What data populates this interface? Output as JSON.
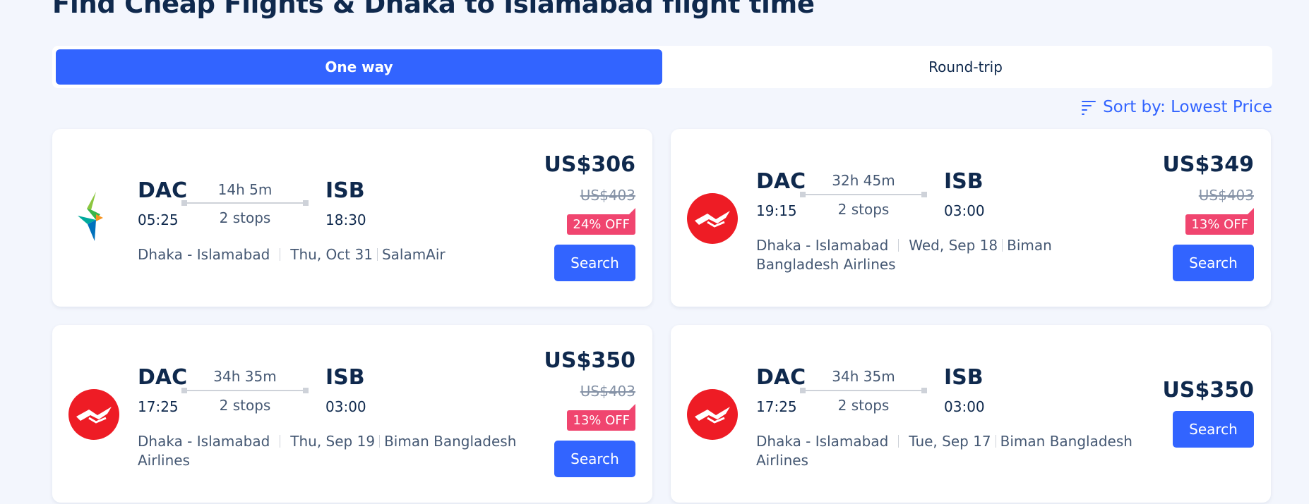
{
  "page_title": "Find Cheap Flights & Dhaka to Islamabad flight time",
  "trip_types": {
    "one_way": "One way",
    "round_trip": "Round-trip",
    "selected": "One way"
  },
  "sort": {
    "label": "Sort by: Lowest Price",
    "icon": "sort-icon"
  },
  "colors": {
    "accent": "#3264ff",
    "discount": "#f0456f",
    "background": "#f3f6fd",
    "biman_red": "#ee1c25"
  },
  "flights": [
    {
      "airline_logo": "salamair-logo",
      "from_code": "DAC",
      "depart_time": "05:25",
      "duration": "14h 5m",
      "stops": "2 stops",
      "to_code": "ISB",
      "arrive_time": "18:30",
      "route": "Dhaka - Islamabad",
      "date": "Thu, Oct 31",
      "airline": "SalamAir",
      "price": "US$306",
      "original_price": "US$403",
      "discount": "24% OFF",
      "button": "Search"
    },
    {
      "airline_logo": "biman-logo",
      "from_code": "DAC",
      "depart_time": "19:15",
      "duration": "32h 45m",
      "stops": "2 stops",
      "to_code": "ISB",
      "arrive_time": "03:00",
      "route": "Dhaka - Islamabad",
      "date": "Wed, Sep 18",
      "airline": "Biman Bangladesh Airlines",
      "price": "US$349",
      "original_price": "US$403",
      "discount": "13% OFF",
      "button": "Search"
    },
    {
      "airline_logo": "biman-logo",
      "from_code": "DAC",
      "depart_time": "17:25",
      "duration": "34h 35m",
      "stops": "2 stops",
      "to_code": "ISB",
      "arrive_time": "03:00",
      "route": "Dhaka - Islamabad",
      "date": "Thu, Sep 19",
      "airline": "Biman Bangladesh Airlines",
      "price": "US$350",
      "original_price": "US$403",
      "discount": "13% OFF",
      "button": "Search"
    },
    {
      "airline_logo": "biman-logo",
      "from_code": "DAC",
      "depart_time": "17:25",
      "duration": "34h 35m",
      "stops": "2 stops",
      "to_code": "ISB",
      "arrive_time": "03:00",
      "route": "Dhaka - Islamabad",
      "date": "Tue, Sep 17",
      "airline": "Biman Bangladesh Airlines",
      "price": "US$350",
      "button": "Search"
    }
  ]
}
